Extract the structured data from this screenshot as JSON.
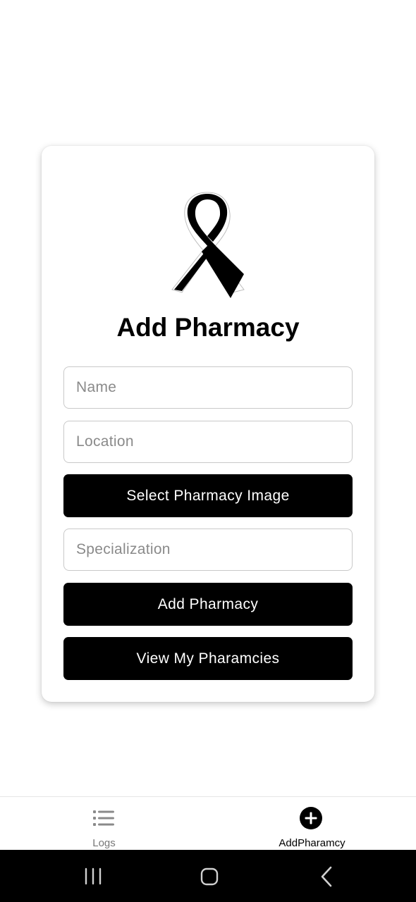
{
  "form": {
    "title": "Add Pharmacy",
    "name_placeholder": "Name",
    "location_placeholder": "Location",
    "select_image_label": "Select Pharmacy Image",
    "specialization_placeholder": "Specialization",
    "add_label": "Add Pharmacy",
    "view_label": "View My Pharamcies",
    "logo_icon": "awareness-ribbon-icon"
  },
  "bottom_nav": {
    "items": [
      {
        "label": "Logs",
        "icon": "list-icon",
        "active": false
      },
      {
        "label": "AddPharamcy",
        "icon": "add-circle-icon",
        "active": true
      }
    ]
  },
  "system_nav": {
    "buttons": [
      "recent-apps-icon",
      "home-icon",
      "back-icon"
    ]
  },
  "colors": {
    "primary": "#000000",
    "background": "#ffffff",
    "border": "#c9c9c9",
    "placeholder": "#8a8a8a",
    "inactive_nav": "#777777"
  }
}
